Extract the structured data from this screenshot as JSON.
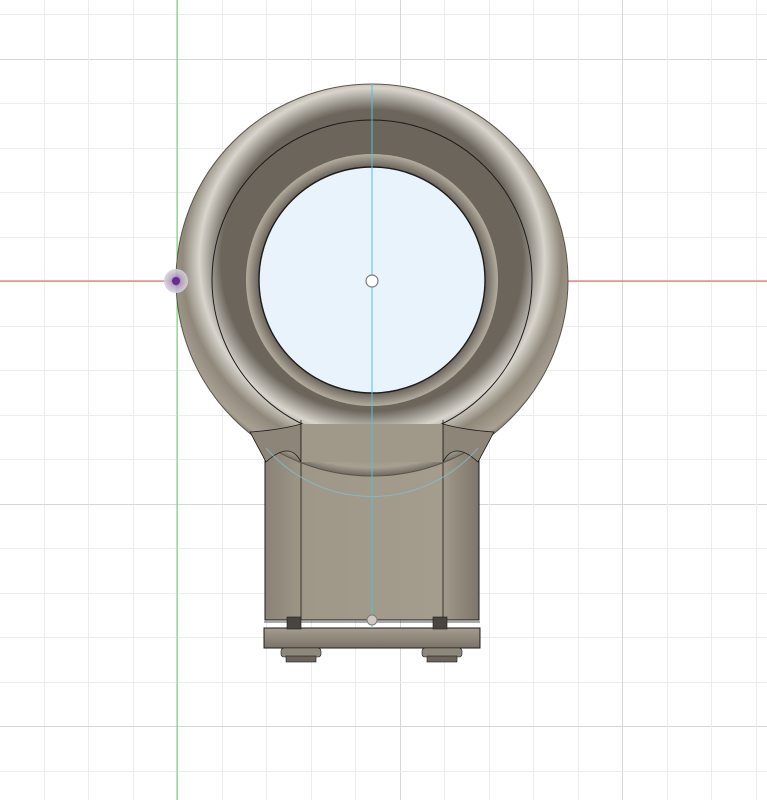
{
  "viewport": {
    "background": "#ffffff",
    "grid_minor_color": "#ececec",
    "grid_major_color": "#d6d6d6"
  },
  "axes": {
    "x_axis_color": "#e05a5a",
    "y_axis_color": "#6fd46f",
    "z_axis_color": "#4fc3d8"
  },
  "model": {
    "body_color": "#9a9182",
    "body_dark": "#5e584f",
    "body_light": "#d8d4cc",
    "hole_fill": "#e8f3fb",
    "edge_color": "#1c1c1c"
  },
  "icons": {
    "origin": "origin-point-icon",
    "sketch_point": "sketch-point-icon"
  }
}
